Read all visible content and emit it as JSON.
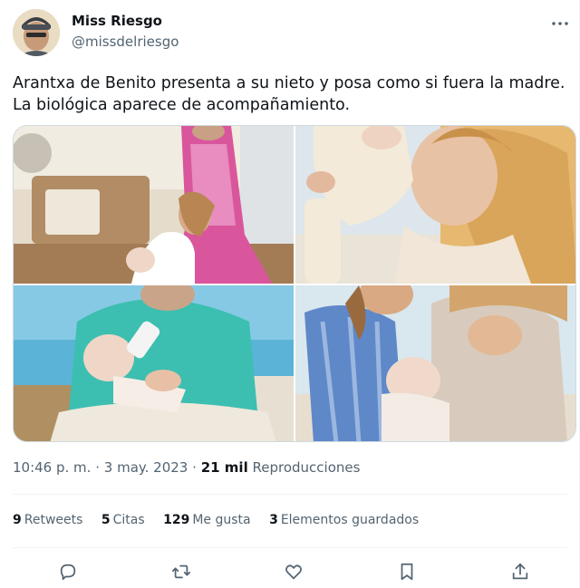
{
  "author": {
    "display_name": "Miss Riesgo",
    "handle": "@missdelriesgo"
  },
  "tweet": {
    "text": "Arantxa de Benito presenta a su nieto y posa como si fuera la madre. La biológica aparece de acompañamiento."
  },
  "meta": {
    "time": "10:46 p. m.",
    "separator1": "·",
    "date": "3 may. 2023",
    "separator2": "·",
    "views_count": "21 mil",
    "views_label": "Reproducciones"
  },
  "stats": {
    "retweets_count": "9",
    "retweets_label": "Retweets",
    "quotes_count": "5",
    "quotes_label": "Citas",
    "likes_count": "129",
    "likes_label": "Me gusta",
    "bookmarks_count": "3",
    "bookmarks_label": "Elementos guardados"
  },
  "icons": {
    "more": "more-icon",
    "reply": "reply-icon",
    "retweet": "retweet-icon",
    "like": "heart-icon",
    "bookmark": "bookmark-icon",
    "share": "share-icon"
  },
  "colors": {
    "text": "#0f1419",
    "secondary": "#536471",
    "divider": "#eff3f4"
  }
}
